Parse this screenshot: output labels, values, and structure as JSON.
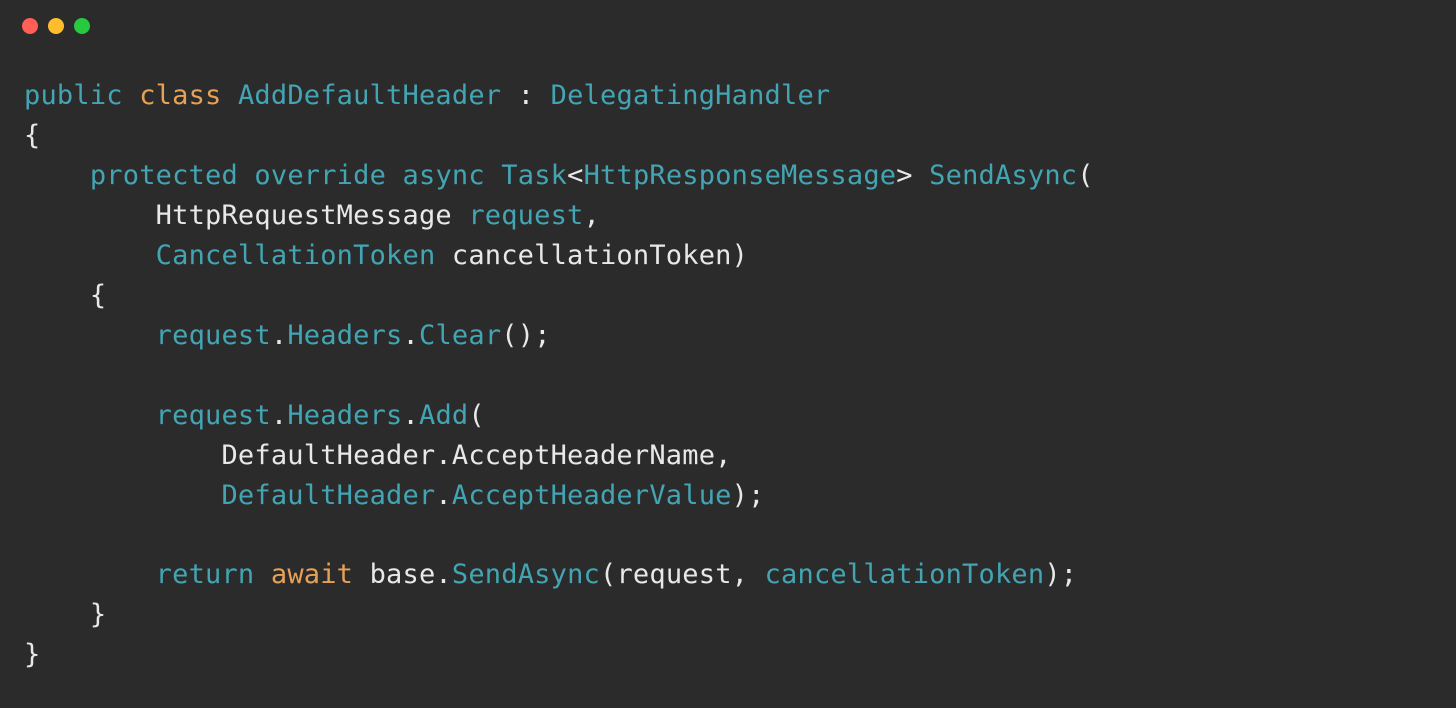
{
  "window": {
    "dots": [
      "red",
      "yellow",
      "green"
    ]
  },
  "code": {
    "line1": {
      "kw1": "public",
      "cls1": "class",
      "type1": "AddDefaultHeader",
      "punct1": " : ",
      "type2": "DelegatingHandler"
    },
    "line2": "{",
    "line3": {
      "indent": "    ",
      "kw1": "protected",
      "kw2": "override",
      "kw3": "async",
      "type1": "Task",
      "punct1": "<",
      "type2": "HttpResponseMessage",
      "punct2": "> ",
      "ident1": "SendAsync",
      "punct3": "("
    },
    "line4": {
      "indent": "        ",
      "plain1": "HttpRequestMessage ",
      "ident1": "request",
      "punct1": ","
    },
    "line5": {
      "indent": "        ",
      "type1": "CancellationToken",
      "plain1": " cancellationToken",
      "punct1": ")"
    },
    "line6": {
      "indent": "    ",
      "punct1": "{"
    },
    "line7": {
      "indent": "        ",
      "ident1": "request",
      "punct1": ".",
      "ident2": "Headers",
      "punct2": ".",
      "ident3": "Clear",
      "punct3": "();"
    },
    "line8": "",
    "line9": {
      "indent": "        ",
      "ident1": "request",
      "punct1": ".",
      "ident2": "Headers",
      "punct2": ".",
      "ident3": "Add",
      "punct3": "("
    },
    "line10": {
      "indent": "            ",
      "plain1": "DefaultHeader",
      "punct1": ".",
      "plain2": "AcceptHeaderName",
      "punct2": ","
    },
    "line11": {
      "indent": "            ",
      "ident1": "DefaultHeader",
      "punct1": ".",
      "ident2": "AcceptHeaderValue",
      "punct2": ");"
    },
    "line12": "",
    "line13": {
      "indent": "        ",
      "kw1": "return",
      "cls1": "await",
      "plain1": " base",
      "punct1": ".",
      "ident1": "SendAsync",
      "punct2": "(",
      "plain2": "request",
      "punct3": ", ",
      "ident2": "cancellationToken",
      "punct4": ");"
    },
    "line14": {
      "indent": "    ",
      "punct1": "}"
    },
    "line15": "}"
  }
}
